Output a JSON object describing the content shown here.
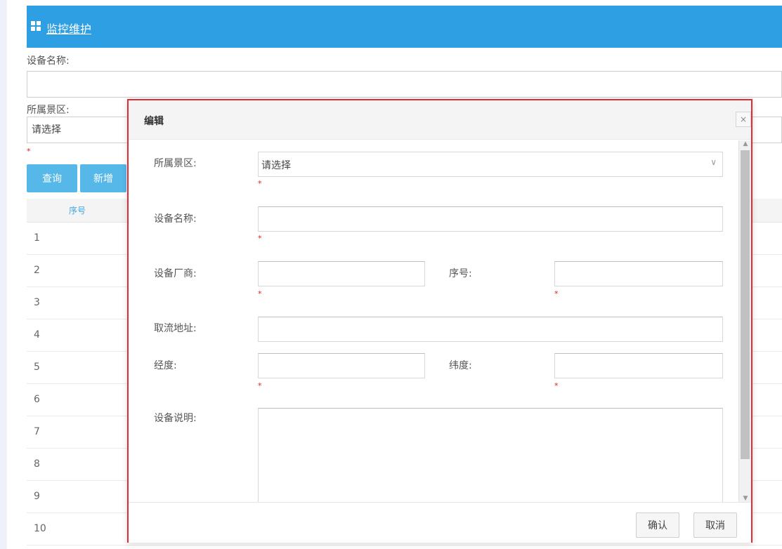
{
  "header": {
    "title": "监控维护",
    "icon": "grid-icon"
  },
  "filters": {
    "device_name_label": "设备名称:",
    "area_label": "所属景区:",
    "area_value": "请选择",
    "required_mark": "*"
  },
  "actions": {
    "query": "查询",
    "add": "新增"
  },
  "table": {
    "header_no": "序号",
    "rows": [
      "1",
      "2",
      "3",
      "4",
      "5",
      "6",
      "7",
      "8",
      "9",
      "10"
    ]
  },
  "modal": {
    "title": "编辑",
    "close": "×",
    "area_label": "所属景区:",
    "area_value": "请选择",
    "device_name_label": "设备名称:",
    "vendor_label": "设备厂商:",
    "serial_label": "序号:",
    "stream_label": "取流地址:",
    "lng_label": "经度:",
    "lat_label": "纬度:",
    "desc_label": "设备说明:",
    "confirm": "确认",
    "cancel": "取消",
    "required_mark": "*"
  },
  "colors": {
    "header": "#2f9fe3",
    "button": "#56b7e9",
    "modal_border": "#e32b36",
    "required": "#e0201f"
  }
}
